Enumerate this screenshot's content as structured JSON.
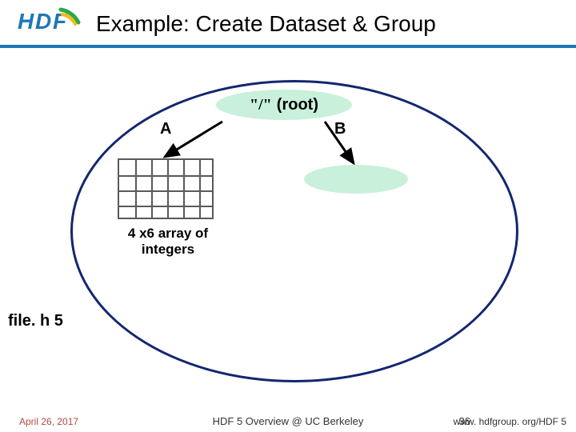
{
  "header": {
    "title": "Example: Create Dataset & Group",
    "logo_text": "HDF",
    "accent_color": "#1f77b4"
  },
  "diagram": {
    "root": {
      "slash": "\"/\"",
      "label": "(root)"
    },
    "link_a_label": "A",
    "link_b_label": "B",
    "array_caption_line1": "4 x6 array of",
    "array_caption_line2": "integers",
    "array_rows": 4,
    "array_cols": 6
  },
  "file_label": "file. h 5",
  "footer": {
    "date": "April 26, 2017",
    "center": "HDF 5 Overview @ UC Berkeley",
    "page": "36",
    "url": "www. hdfgroup. org/HDF 5"
  }
}
